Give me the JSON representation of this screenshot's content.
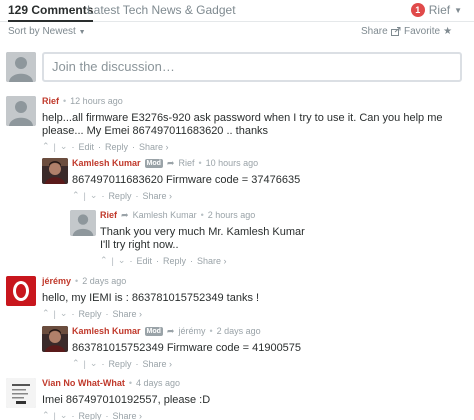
{
  "nav": {
    "comments_count": "129 Comments",
    "site_tab": "Latest Tech News & Gadget",
    "user_name": "Rief",
    "notification_count": "1"
  },
  "sort": {
    "label": "Sort by Newest",
    "share": "Share",
    "favorite": "Favorite"
  },
  "compose": {
    "placeholder": "Join the discussion…"
  },
  "footer_labels": {
    "edit": "Edit",
    "reply": "Reply",
    "share": "Share ›",
    "sep": "·",
    "vote_sep": "|"
  },
  "comments": [
    {
      "author": "Rief",
      "time": "12 hours ago",
      "text": "help...all firmware E3276s-920 ask password when I try to use it. Can you help me please... My Emei 867497011683620 .. thanks",
      "avatar": "generic"
    },
    {
      "author": "Kamlesh Kumar",
      "badge": "Mod",
      "reply_to": "Rief",
      "time": "10 hours ago",
      "text": "867497011683620 Firmware code = 37476635",
      "avatar": "photo"
    },
    {
      "author": "Rief",
      "reply_to": "Kamlesh Kumar",
      "time": "2 hours ago",
      "text_lines": [
        "Thank you very much Mr. Kamlesh Kumar",
        "I'll try right now.."
      ],
      "avatar": "generic"
    },
    {
      "author": "jérémy",
      "time": "2 days ago",
      "text": "hello, my IEMI is : 863781015752349 tanks !",
      "avatar": "red"
    },
    {
      "author": "Kamlesh Kumar",
      "badge": "Mod",
      "reply_to": "jérémy",
      "time": "2 days ago",
      "text": "863781015752349 Firmware code = 41900575",
      "avatar": "photo"
    },
    {
      "author": "Vian No What-What",
      "time": "4 days ago",
      "text": "Imei 867497010192557, please :D",
      "avatar": "doc"
    }
  ],
  "colors": {
    "author": "#c0392b",
    "notif": "#e04a4a",
    "muted": "#9aa3a8"
  }
}
